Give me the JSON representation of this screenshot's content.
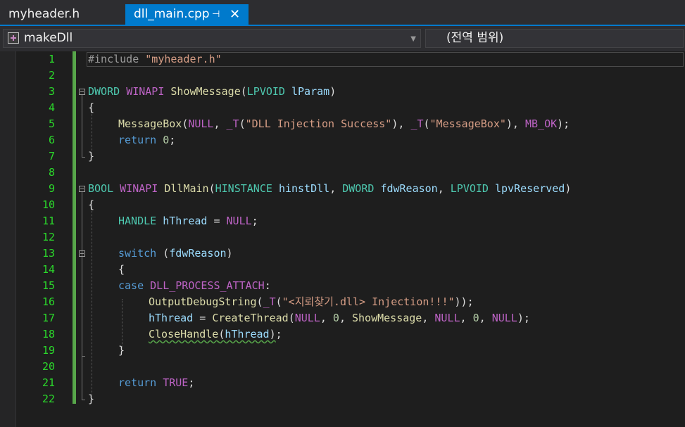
{
  "tabs": [
    {
      "label": "myheader.h",
      "active": false
    },
    {
      "label": "dll_main.cpp",
      "active": true
    }
  ],
  "tab_pin_glyph": "⊣",
  "tab_close_glyph": "✕",
  "navbar": {
    "project": "makeDll",
    "scope": "(전역 범위)",
    "dropdown_glyph": "▼"
  },
  "fold_glyph": "⊟",
  "line_numbers": [
    "1",
    "2",
    "3",
    "4",
    "5",
    "6",
    "7",
    "8",
    "9",
    "10",
    "11",
    "12",
    "13",
    "14",
    "15",
    "16",
    "17",
    "18",
    "19",
    "20",
    "21",
    "22"
  ],
  "code": {
    "l1": {
      "directive": "#include",
      "sp": " ",
      "file": "\"myheader.h\""
    },
    "l3": {
      "t1": "DWORD",
      "sp1": " ",
      "t2": "WINAPI",
      "sp2": " ",
      "fn": "ShowMessage",
      "op": "(",
      "t3": "LPVOID",
      "sp3": " ",
      "p": "lParam",
      "cp": ")"
    },
    "l4": {
      "b": "{"
    },
    "l5": {
      "fn": "MessageBox",
      "a": "(",
      "m1": "NULL",
      "b": ", ",
      "m2": "_T",
      "c": "(",
      "s1": "\"DLL Injection Success\"",
      "d": "), ",
      "m3": "_T",
      "e": "(",
      "s2": "\"MessageBox\"",
      "f": "), ",
      "m4": "MB_OK",
      "g": ");"
    },
    "l6": {
      "kw": "return",
      "sp": " ",
      "n": "0",
      "e": ";"
    },
    "l7": {
      "b": "}"
    },
    "l9": {
      "t1": "BOOL",
      "sp1": " ",
      "t2": "WINAPI",
      "sp2": " ",
      "fn": "DllMain",
      "op": "(",
      "t3": "HINSTANCE",
      "sp3": " ",
      "p1": "hinstDll",
      "c1": ", ",
      "t4": "DWORD",
      "sp4": " ",
      "p2": "fdwReason",
      "c2": ", ",
      "t5": "LPVOID",
      "sp5": " ",
      "p3": "lpvReserved",
      "cp": ")"
    },
    "l10": {
      "b": "{"
    },
    "l11": {
      "t": "HANDLE",
      "sp": " ",
      "v": "hThread",
      "eq": " = ",
      "m": "NULL",
      "e": ";"
    },
    "l13": {
      "kw": "switch",
      "sp": " ",
      "op": "(",
      "p": "fdwReason",
      "cp": ")"
    },
    "l14": {
      "b": "{"
    },
    "l15": {
      "kw": "case",
      "sp": " ",
      "m": "DLL_PROCESS_ATTACH",
      "c": ":"
    },
    "l16": {
      "fn": "OutputDebugString",
      "a": "(",
      "m": "_T",
      "b": "(",
      "s": "\"<지뢰찾기.dll> Injection!!!\"",
      "c": "));"
    },
    "l17": {
      "v": "hThread",
      "eq": " = ",
      "fn": "CreateThread",
      "a": "(",
      "m1": "NULL",
      "b": ", ",
      "n1": "0",
      "c": ", ",
      "f2": "ShowMessage",
      "d": ", ",
      "m2": "NULL",
      "e": ", ",
      "n2": "0",
      "f": ", ",
      "m3": "NULL",
      "g": ");"
    },
    "l18": {
      "fn": "CloseHandle",
      "a": "(",
      "v": "hThread",
      "b": ")",
      "e": ";"
    },
    "l19": {
      "b": "}"
    },
    "l21": {
      "kw": "return",
      "sp": " ",
      "m": "TRUE",
      "e": ";"
    },
    "l22": {
      "b": "}"
    }
  },
  "colors": {
    "accent": "#007acc",
    "editor_bg": "#1e1e1e",
    "line_number": "#2bd92b",
    "change_bar": "#57a64a",
    "keyword": "#569cd6",
    "type": "#4ec9b0",
    "macro": "#bd63c5",
    "function": "#dcdcaa",
    "string": "#d69d85",
    "parameter": "#9cdcfe"
  }
}
